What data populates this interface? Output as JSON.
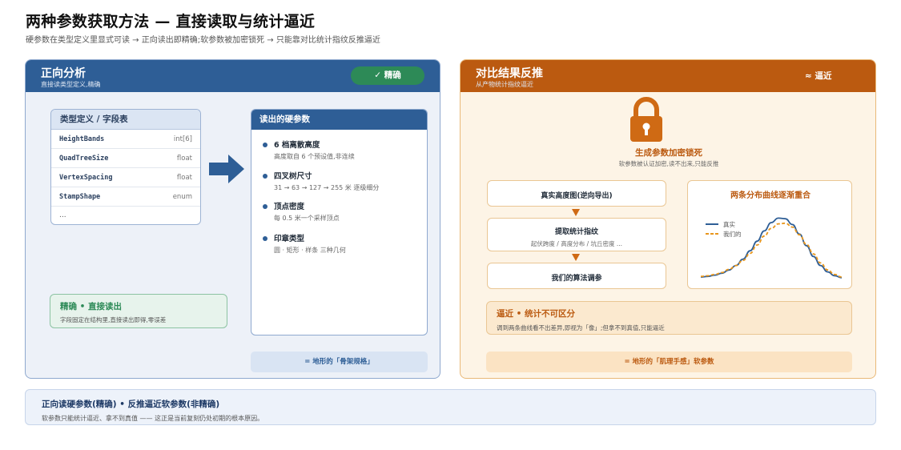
{
  "header": {
    "title": "两种参数获取方法 — 直接读取与统计逼近",
    "subtitle": "硬参数在类型定义里显式可读 → 正向读出即精确;软参数被加密锁死 → 只能靠对比统计指纹反推逼近"
  },
  "left": {
    "title": "正向分析",
    "subtitle": "直接读类型定义,精确",
    "badge": "✓ 精确",
    "type_table": {
      "title": "类型定义 / 字段表",
      "rows": [
        {
          "name": "HeightBands",
          "type": "int[6]"
        },
        {
          "name": "QuadTreeSize",
          "type": "float"
        },
        {
          "name": "VertexSpacing",
          "type": "float"
        },
        {
          "name": "StampShape",
          "type": "enum"
        }
      ],
      "more": "..."
    },
    "hard_params": {
      "title": "读出的硬参数",
      "items": [
        {
          "title": "6 档离散高度",
          "desc": "高度取自 6 个预设值,非连续"
        },
        {
          "title": "四叉树尺寸",
          "desc": "31 → 63 → 127 → 255 米 逐级细分"
        },
        {
          "title": "顶点密度",
          "desc": "每 0.5 米一个采样顶点"
        },
        {
          "title": "印章类型",
          "desc": "圆 · 矩形 · 样条 三种几何"
        }
      ]
    },
    "exact": {
      "title": "精确 • 直接读出",
      "desc": "字段固定在结构里,直接读出即得,零误差"
    },
    "footer": "= 地形的「骨架规格」"
  },
  "right": {
    "title": "对比结果反推",
    "subtitle": "从产物统计指纹逼近",
    "badge": "≈ 逼近",
    "lock": {
      "icon": "lock-icon",
      "title": "生成参数加密锁死",
      "desc": "软参数被认证加密,读不出来,只能反推"
    },
    "steps": [
      {
        "title": "真实高度图(逆向导出)",
        "desc": ""
      },
      {
        "title": "提取统计指纹",
        "desc": "起伏跨度 / 高度分布 / 坑丘密度 ..."
      },
      {
        "title": "我们的算法调参",
        "desc": ""
      }
    ],
    "chart_title": "两条分布曲线逐渐重合",
    "approx": {
      "title": "逼近 • 统计不可区分",
      "desc": "调到两条曲线看不出差异,即视为「像」;但拿不到真值,只能逼近"
    },
    "footer": "= 地形的「肌理手感」软参数"
  },
  "chart_data": {
    "type": "line",
    "title": "两条分布曲线逐渐重合",
    "xlabel": "",
    "ylabel": "",
    "x": [
      0,
      1,
      2,
      3,
      4,
      5,
      6,
      7,
      8,
      9,
      10,
      11,
      12,
      13,
      14,
      15,
      16,
      17,
      18,
      19,
      20
    ],
    "series": [
      {
        "name": "真实",
        "color": "#2e5e96",
        "style": "solid",
        "values": [
          0.05,
          0.06,
          0.08,
          0.11,
          0.16,
          0.23,
          0.33,
          0.46,
          0.61,
          0.77,
          0.9,
          0.97,
          0.96,
          0.87,
          0.72,
          0.54,
          0.37,
          0.23,
          0.13,
          0.07,
          0.04
        ]
      },
      {
        "name": "我们的",
        "color": "#e8961c",
        "style": "dashed",
        "values": [
          0.06,
          0.07,
          0.09,
          0.12,
          0.17,
          0.23,
          0.31,
          0.42,
          0.55,
          0.69,
          0.81,
          0.88,
          0.89,
          0.83,
          0.71,
          0.56,
          0.41,
          0.27,
          0.16,
          0.09,
          0.05
        ]
      }
    ],
    "ylim": [
      0,
      1.1
    ],
    "grid": false,
    "legend": "top-left"
  },
  "summary": {
    "title": "正向读硬参数(精确) • 反推逼近软参数(非精确)",
    "desc": "软参数只能统计逼近、拿不到真值 —— 这正是当前复刻仍处初期的根本原因。"
  },
  "colors": {
    "left_accent": "#2e5e96",
    "right_accent": "#bb5a10",
    "exact_green": "#2d8a57"
  }
}
